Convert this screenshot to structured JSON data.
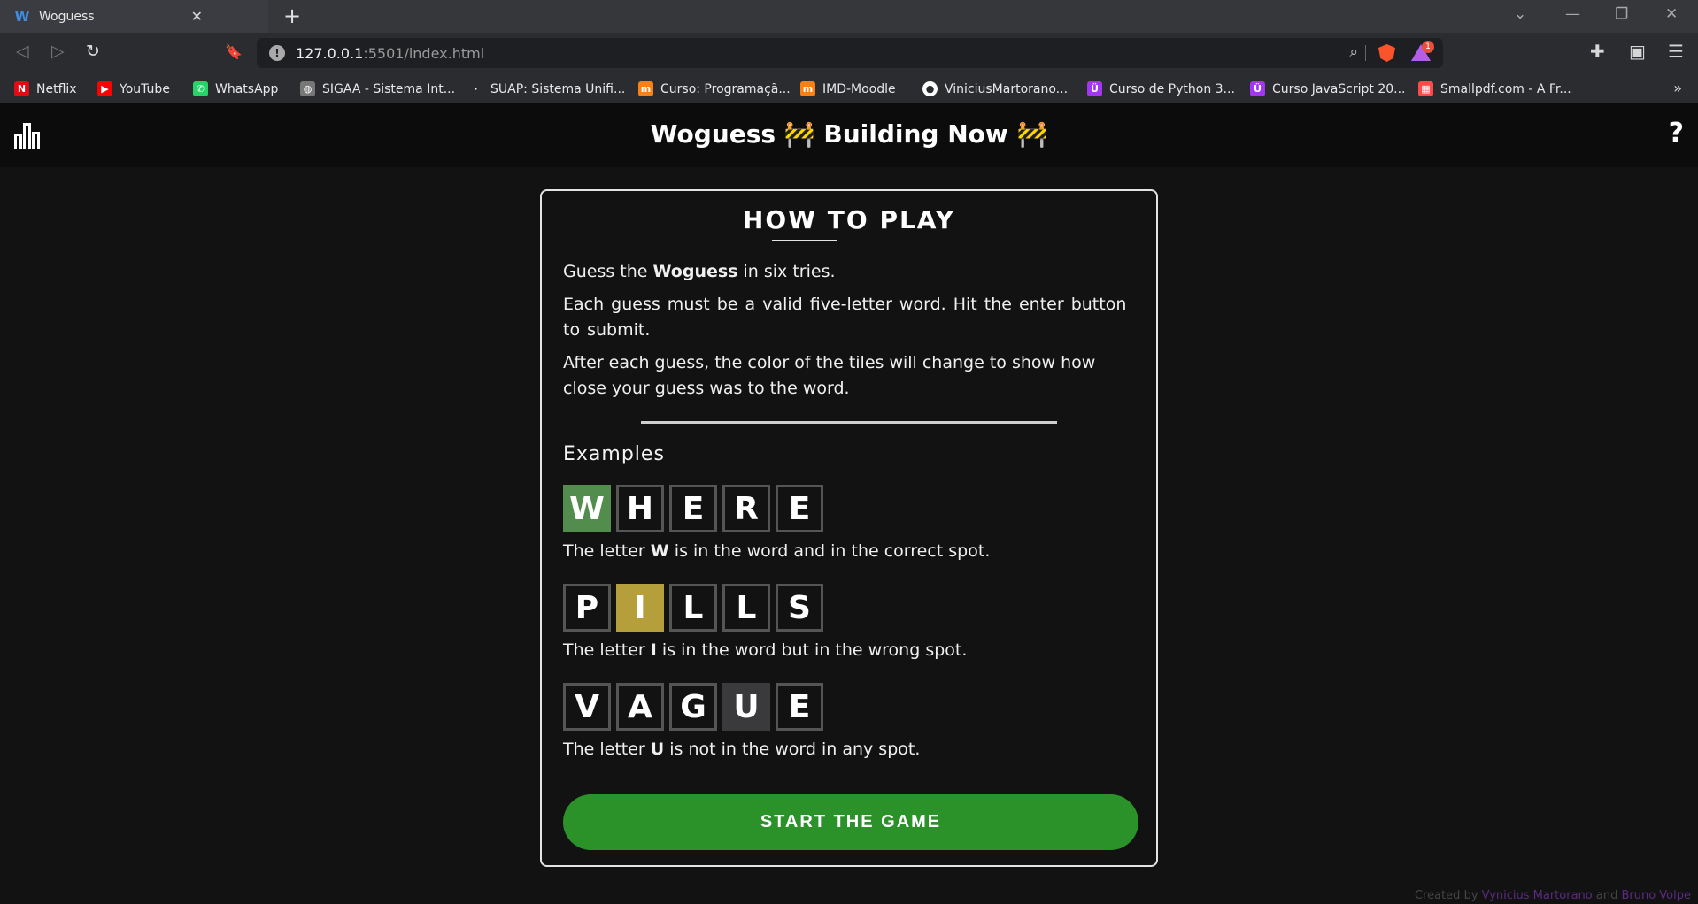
{
  "browser": {
    "tab": {
      "favicon": "W",
      "title": "Woguess",
      "close": "✕"
    },
    "new_tab": "+",
    "window_controls": [
      "⌄",
      "—",
      "❐",
      "✕"
    ],
    "nav": {
      "back": "◁",
      "forward": "▷",
      "reload": "↻",
      "bookmark": "🔖"
    },
    "url": {
      "host": "127.0.0.1",
      "rest": ":5501/index.html",
      "info_icon": "!"
    },
    "rewards_badge": "1",
    "bookmarks": [
      {
        "label": "Netflix",
        "icon": "netflix-icon",
        "color": "#e50914",
        "glyph": "N"
      },
      {
        "label": "YouTube",
        "icon": "youtube-icon",
        "color": "#ff0000",
        "glyph": "▶"
      },
      {
        "label": "WhatsApp",
        "icon": "whatsapp-icon",
        "color": "#25d366",
        "glyph": "✆"
      },
      {
        "label": "SIGAA - Sistema Int...",
        "icon": "globe-icon",
        "color": "#777777",
        "glyph": "◍"
      },
      {
        "label": "SUAP: Sistema Unifi...",
        "icon": "suap-icon",
        "color": "#2b2c30",
        "glyph": "·"
      },
      {
        "label": "Curso: Programaçã...",
        "icon": "moodle-icon",
        "color": "#f98012",
        "glyph": "m"
      },
      {
        "label": "IMD-Moodle",
        "icon": "moodle-icon",
        "color": "#f98012",
        "glyph": "m"
      },
      {
        "label": "ViniciusMartorano...",
        "icon": "github-icon",
        "color": "#ffffff",
        "glyph": "●"
      },
      {
        "label": "Curso de Python 3...",
        "icon": "udemy-icon",
        "color": "#a435f0",
        "glyph": "Ü"
      },
      {
        "label": "Curso JavaScript 20...",
        "icon": "udemy-icon",
        "color": "#a435f0",
        "glyph": "Ü"
      },
      {
        "label": "Smallpdf.com - A Fr...",
        "icon": "smallpdf-icon",
        "color": "#ff4a4a",
        "glyph": "▦"
      }
    ],
    "bookmarks_more": "»"
  },
  "header": {
    "title": "Woguess 🚧 Building Now 🚧",
    "help": "?"
  },
  "modal": {
    "title": "HOW TO PLAY",
    "p1": {
      "pre": "Guess the ",
      "bold": "Woguess",
      "post": " in six tries."
    },
    "p2": "Each guess must be a valid five-letter word. Hit the enter button to submit.",
    "p3": "After each guess, the color of the tiles will change to show how close your guess was to the word.",
    "examples_title": "Examples",
    "examples": [
      {
        "letters": [
          "W",
          "H",
          "E",
          "R",
          "E"
        ],
        "highlight": 0,
        "state": "correct",
        "pre": "The letter ",
        "bold": "W",
        "post": " is in the word and in the correct spot."
      },
      {
        "letters": [
          "P",
          "I",
          "L",
          "L",
          "S"
        ],
        "highlight": 1,
        "state": "present",
        "pre": "The letter ",
        "bold": "I",
        "post": " is in the word but in the wrong spot."
      },
      {
        "letters": [
          "V",
          "A",
          "G",
          "U",
          "E"
        ],
        "highlight": 3,
        "state": "absent",
        "pre": "The letter ",
        "bold": "U",
        "post": " is not in the word in any spot."
      }
    ],
    "start_button": "START THE GAME"
  },
  "credits": {
    "pre": "Created by ",
    "author1": "Vynicius Martorano",
    "mid": " and ",
    "author2": "Bruno Volpe"
  },
  "colors": {
    "correct": "#538d4e",
    "present": "#b59f3b",
    "absent": "#3a3a3c",
    "start_button": "#2b9229"
  }
}
